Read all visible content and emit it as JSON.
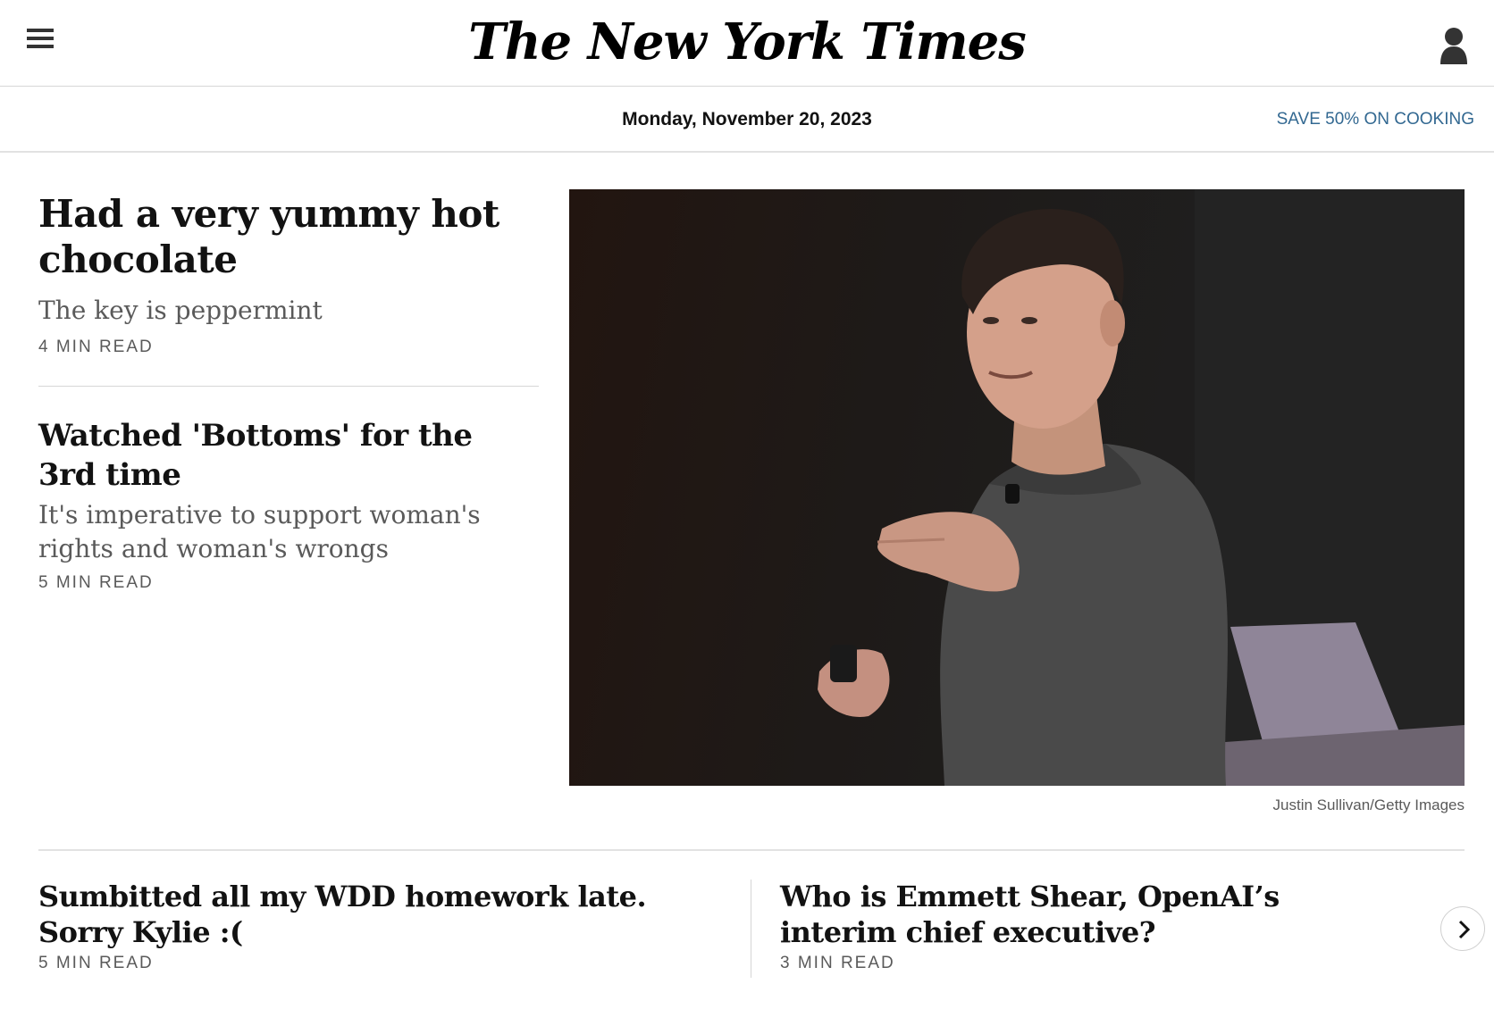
{
  "header": {
    "logo": "The New York Times",
    "menu_icon": "hamburger-menu-icon",
    "user_icon": "user-account-icon"
  },
  "datebar": {
    "date": "Monday, November 20, 2023",
    "promo": "SAVE 50% ON COOKING"
  },
  "stories": [
    {
      "headline": "Had a very yummy hot chocolate",
      "summary": "The key is peppermint",
      "read_time": "4 MIN READ"
    },
    {
      "headline": "Watched 'Bottoms' for the 3rd time",
      "summary": "It's imperative to support woman's rights and woman's wrongs",
      "read_time": "5 MIN READ"
    }
  ],
  "photo": {
    "credit": "Justin Sullivan/Getty Images"
  },
  "bottom_stories": [
    {
      "headline": "Sumbitted all my WDD homework late. Sorry Kylie :(",
      "read_time": "5 MIN READ"
    },
    {
      "headline": "Who is Emmett Shear, OpenAI’s interim chief executive?",
      "read_time": "3 MIN READ"
    }
  ],
  "colors": {
    "link_blue": "#326891",
    "text": "#121212",
    "muted": "#5a5a5a"
  }
}
